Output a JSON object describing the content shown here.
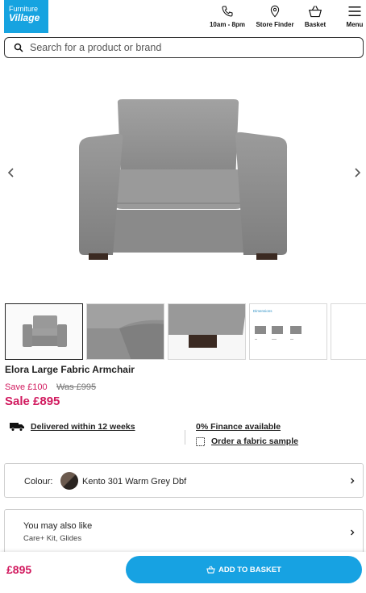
{
  "header": {
    "logo_line1": "Furniture",
    "logo_line2": "Village",
    "hours_label": "10am - 8pm",
    "store_finder_label": "Store Finder",
    "basket_label": "Basket",
    "menu_label": "Menu"
  },
  "search": {
    "placeholder": "Search for a product or brand"
  },
  "gallery": {
    "thumbnails": [
      "armchair-front",
      "fabric-detail-arm",
      "fabric-detail-foot",
      "dimensions-sheet",
      "more"
    ],
    "dimensions_heading": "Dimensions"
  },
  "product": {
    "title": "Elora Large Fabric Armchair",
    "save_text": "Save £100",
    "was_text": "Was £995",
    "sale_text": "Sale £895"
  },
  "features": {
    "delivery": "Delivered within 12 weeks",
    "finance": "0% Finance available",
    "fabric_sample": "Order a fabric sample"
  },
  "colour": {
    "label": "Colour:",
    "value": "Kento 301 Warm Grey Dbf"
  },
  "also_like": {
    "heading": "You may also like",
    "subtitle": "Care+ Kit, Glides"
  },
  "bottom_bar": {
    "price": "£895",
    "button_label": "ADD TO BASKET"
  },
  "colors": {
    "brand_blue": "#16a3e0",
    "sale_pink": "#d1195e",
    "fabric_grey": "#8e8e8e"
  }
}
